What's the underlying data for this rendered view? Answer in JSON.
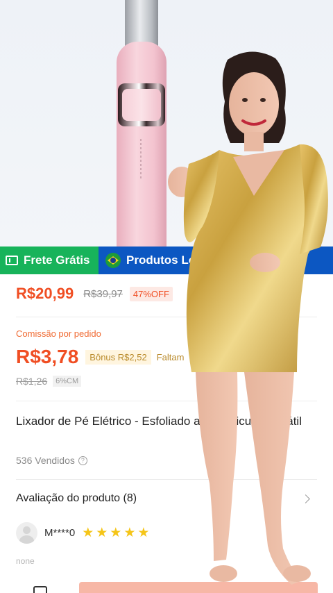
{
  "badges": {
    "free_shipping": "Frete Grátis",
    "local_products": "Produtos Loc"
  },
  "pricing": {
    "price": "R$20,99",
    "original_price": "R$39,97",
    "discount": "47%OFF"
  },
  "commission": {
    "label": "Comissão por pedido",
    "value": "R$3,78",
    "bonus": "Bônus R$2,52",
    "faltam": "Faltam",
    "old_value": "R$1,26",
    "rate": "6%CM"
  },
  "product": {
    "title": "Lixador de Pé Elétrico - Esfoliado        a C Pedicure Portátil",
    "sold": "536 Vendidos"
  },
  "rating": {
    "heading": "Avaliação do produto (8)",
    "reviewer": "M****0",
    "stars": 5,
    "review_text": "none"
  },
  "colors": {
    "accent": "#f04e23",
    "free_shipping_bg": "#17b35a",
    "local_bg": "#0c57c2",
    "star": "#f5c518"
  }
}
